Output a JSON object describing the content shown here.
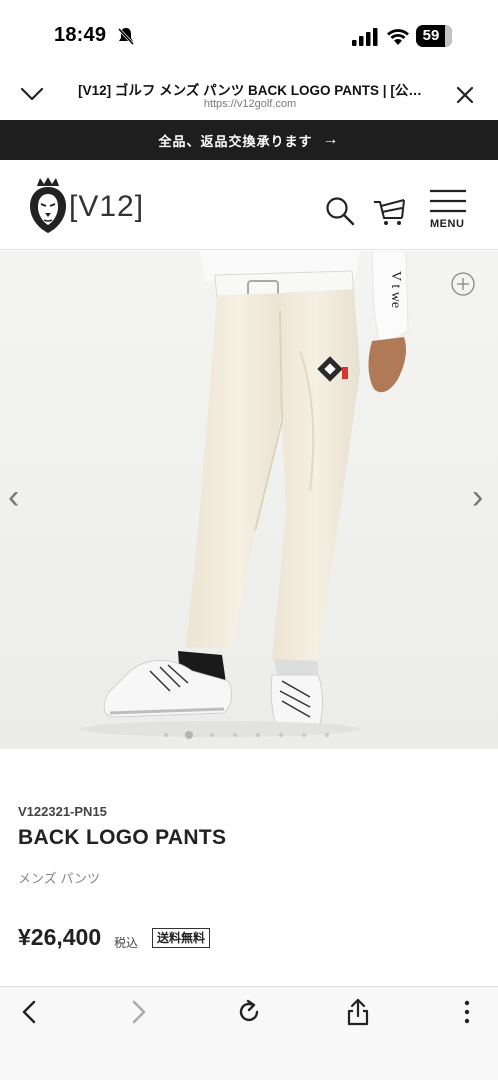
{
  "status": {
    "time": "18:49",
    "battery": "59"
  },
  "browser": {
    "page_title": "[V12] ゴルフ メンズ パンツ BACK LOGO PANTS | [公…",
    "domain": "https://v12golf.com"
  },
  "banner": {
    "text": "全品、返品交換承ります",
    "arrow": "→"
  },
  "header": {
    "logo": "[V12]",
    "menu_label": "MENU"
  },
  "gallery": {
    "slide_count": 8,
    "active_index": 1,
    "prev": "‹",
    "next": "›"
  },
  "product": {
    "sku": "V122321-PN15",
    "name": "BACK LOGO PANTS",
    "category": "メンズ パンツ",
    "price": "¥26,400",
    "tax_label": "税込",
    "shipping_badge": "送料無料"
  },
  "colors": {
    "banner_bg": "#1e1e1e",
    "pants": "#f3ede0",
    "accent_red": "#d9342b"
  }
}
